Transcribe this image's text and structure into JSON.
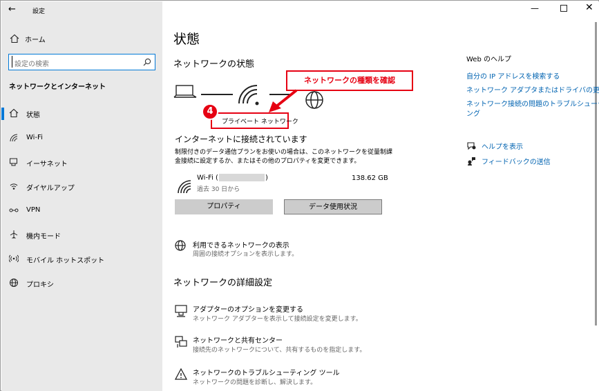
{
  "window": {
    "title": "設定"
  },
  "sidebar": {
    "home_label": "ホーム",
    "search_placeholder": "設定の検索",
    "section_title": "ネットワークとインターネット",
    "items": [
      {
        "label": "状態",
        "icon": "home-status-icon"
      },
      {
        "label": "Wi-Fi",
        "icon": "wifi-icon"
      },
      {
        "label": "イーサネット",
        "icon": "ethernet-icon"
      },
      {
        "label": "ダイヤルアップ",
        "icon": "dialup-icon"
      },
      {
        "label": "VPN",
        "icon": "vpn-icon"
      },
      {
        "label": "機内モード",
        "icon": "airplane-icon"
      },
      {
        "label": "モバイル ホットスポット",
        "icon": "hotspot-icon"
      },
      {
        "label": "プロキシ",
        "icon": "globe-icon"
      }
    ]
  },
  "main": {
    "page_title": "状態",
    "network_status_heading": "ネットワークの状態",
    "network_type": "プライベート ネットワーク",
    "connected_text": "インターネットに接続されています",
    "description_line1": "制限付きのデータ通信プランをお使いの場合は、このネットワークを従量制課",
    "description_line2": "金接続に設定するか、またはその他のプロパティを変更できます。",
    "connection": {
      "name": "Wi-Fi (",
      "name_suffix": ")",
      "subtitle": "過去 30 日から",
      "usage": "138.62 GB"
    },
    "buttons": {
      "properties": "プロパティ",
      "data_usage": "データ使用状況"
    },
    "show_networks": {
      "title": "利用できるネットワークの表示",
      "subtitle": "周囲の接続オプションを表示します。"
    },
    "advanced_heading": "ネットワークの詳細設定",
    "advanced_items": [
      {
        "title": "アダプターのオプションを変更する",
        "subtitle": "ネットワーク アダプターを表示して接続設定を変更します。"
      },
      {
        "title": "ネットワークと共有センター",
        "subtitle": "接続先のネットワークについて、共有するものを指定します。"
      },
      {
        "title": "ネットワークのトラブルシューティング ツール",
        "subtitle": "ネットワークの問題を診断し、解決します。"
      }
    ]
  },
  "help": {
    "heading": "Web のヘルプ",
    "links": [
      "自分の IP アドレスを検索する",
      "ネットワーク アダプタまたはドライバの更新",
      "ネットワーク接続の問題のトラブルシューティ",
      "ング"
    ],
    "show_help": "ヘルプを表示",
    "feedback": "フィードバックの送信"
  },
  "annotation": {
    "callout_text": "ネットワークの種類を確認",
    "step_number": "4",
    "accent_color": "#e60012"
  }
}
